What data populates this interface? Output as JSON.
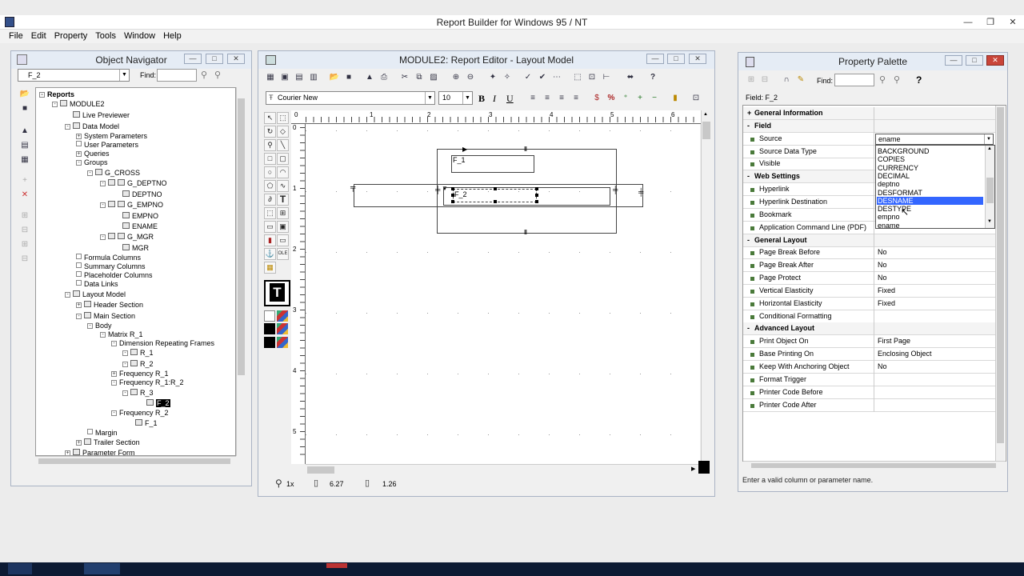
{
  "app": {
    "title": "Report Builder for Windows 95 / NT"
  },
  "menu": [
    "File",
    "Edit",
    "Property",
    "Tools",
    "Window",
    "Help"
  ],
  "navigator": {
    "title": "Object Navigator",
    "object_select": "F_2",
    "find_label": "Find:",
    "tree": [
      {
        "label": "Reports",
        "bold": true
      },
      {
        "label": "MODULE2"
      },
      {
        "label": "Live Previewer"
      },
      {
        "label": "Data Model"
      },
      {
        "label": "System Parameters"
      },
      {
        "label": "User Parameters"
      },
      {
        "label": "Queries"
      },
      {
        "label": "Groups"
      },
      {
        "label": "G_CROSS"
      },
      {
        "label": "G_DEPTNO"
      },
      {
        "label": "DEPTNO"
      },
      {
        "label": "G_EMPNO"
      },
      {
        "label": "EMPNO"
      },
      {
        "label": "ENAME"
      },
      {
        "label": "G_MGR"
      },
      {
        "label": "MGR"
      },
      {
        "label": "Formula Columns"
      },
      {
        "label": "Summary Columns"
      },
      {
        "label": "Placeholder Columns"
      },
      {
        "label": "Data Links"
      },
      {
        "label": "Layout Model"
      },
      {
        "label": "Header Section"
      },
      {
        "label": "Main Section"
      },
      {
        "label": "Body"
      },
      {
        "label": "Matrix R_1"
      },
      {
        "label": "Dimension Repeating Frames"
      },
      {
        "label": "R_1"
      },
      {
        "label": "R_2"
      },
      {
        "label": "Frequency R_1"
      },
      {
        "label": "Frequency R_1:R_2"
      },
      {
        "label": "R_3"
      },
      {
        "label": "F_2"
      },
      {
        "label": "Frequency R_2"
      },
      {
        "label": "F_1"
      },
      {
        "label": "Margin"
      },
      {
        "label": "Trailer Section"
      },
      {
        "label": "Parameter Form"
      }
    ]
  },
  "editor": {
    "title": "MODULE2: Report Editor - Layout Model",
    "font_name": "Courier New",
    "font_size": "10",
    "bold": "B",
    "italic": "I",
    "underline": "U",
    "ruler_h": [
      "0",
      "1",
      "2",
      "3",
      "4",
      "5",
      "6"
    ],
    "ruler_v": [
      "0",
      "1",
      "2",
      "3",
      "4",
      "5"
    ],
    "frame_f1": "F_1",
    "frame_f2": "F_2",
    "status_zoom": "1x",
    "status_x": "6.27",
    "status_y": "1.26",
    "text_tool": "T"
  },
  "palette": {
    "title": "Property Palette",
    "find_label": "Find:",
    "field_label": "Field: F_2",
    "help": "?",
    "rows": [
      {
        "name": "General Information",
        "header": true,
        "toggle": "+"
      },
      {
        "name": "Field",
        "header": true,
        "toggle": "-"
      },
      {
        "name": "Source",
        "value": "ename"
      },
      {
        "name": "Source Data Type",
        "value": ""
      },
      {
        "name": "Visible",
        "value": ""
      },
      {
        "name": "Web Settings",
        "header": true,
        "toggle": "-"
      },
      {
        "name": "Hyperlink",
        "value": ""
      },
      {
        "name": "Hyperlink Destination",
        "value": ""
      },
      {
        "name": "Bookmark",
        "value": ""
      },
      {
        "name": "Application Command Line (PDF)",
        "value": ""
      },
      {
        "name": "General Layout",
        "header": true,
        "toggle": "-"
      },
      {
        "name": "Page Break Before",
        "value": "No"
      },
      {
        "name": "Page Break After",
        "value": "No"
      },
      {
        "name": "Page Protect",
        "value": "No"
      },
      {
        "name": "Vertical Elasticity",
        "value": "Fixed"
      },
      {
        "name": "Horizontal Elasticity",
        "value": "Fixed"
      },
      {
        "name": "Conditional Formatting",
        "value": ""
      },
      {
        "name": "Advanced Layout",
        "header": true,
        "toggle": "-"
      },
      {
        "name": "Print Object On",
        "value": "First Page"
      },
      {
        "name": "Base Printing On",
        "value": "Enclosing Object"
      },
      {
        "name": "Keep With Anchoring Object",
        "value": "No"
      },
      {
        "name": "Format Trigger",
        "value": ""
      },
      {
        "name": "Printer Code Before",
        "value": ""
      },
      {
        "name": "Printer Code After",
        "value": ""
      }
    ],
    "dropdown_options": [
      "BACKGROUND",
      "COPIES",
      "CURRENCY",
      "DECIMAL",
      "deptno",
      "DESFORMAT",
      "DESNAME",
      "DESTYPE",
      "empno",
      "ename"
    ],
    "dropdown_selected": "DESNAME",
    "hint": "Enter a valid column or parameter name."
  },
  "colors": {
    "selection": "#3366ff",
    "desktop": "#ececec",
    "taskbar": "#0c1a33"
  }
}
